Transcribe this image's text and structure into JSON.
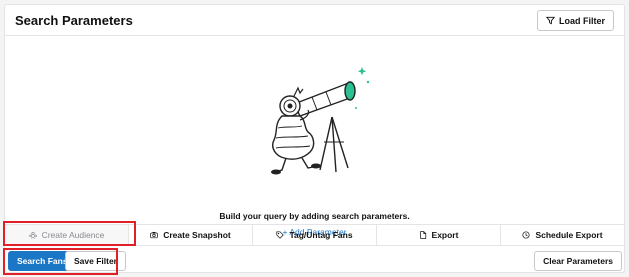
{
  "header": {
    "title": "Search Parameters",
    "load_filter_label": "Load Filter"
  },
  "empty_state": {
    "message": "Build your query by adding search parameters.",
    "add_parameter_label": "+ Add Parameter"
  },
  "actions": {
    "create_audience": "Create Audience",
    "create_snapshot": "Create Snapshot",
    "tag_untag": "Tag/Untag Fans",
    "export": "Export",
    "schedule_export": "Schedule Export"
  },
  "footer": {
    "search_label": "Search Fans",
    "save_label": "Save Filter",
    "clear_label": "Clear Parameters"
  },
  "colors": {
    "primary": "#1b77c5",
    "link": "#1d74c9",
    "highlight": "#e01f26",
    "accent_teal": "#2bbf93"
  },
  "icons": {
    "load_filter": "filter-icon",
    "create_audience": "audience-icon",
    "create_snapshot": "camera-icon",
    "tag_untag": "tag-icon",
    "export": "file-icon",
    "schedule_export": "clock-icon"
  }
}
